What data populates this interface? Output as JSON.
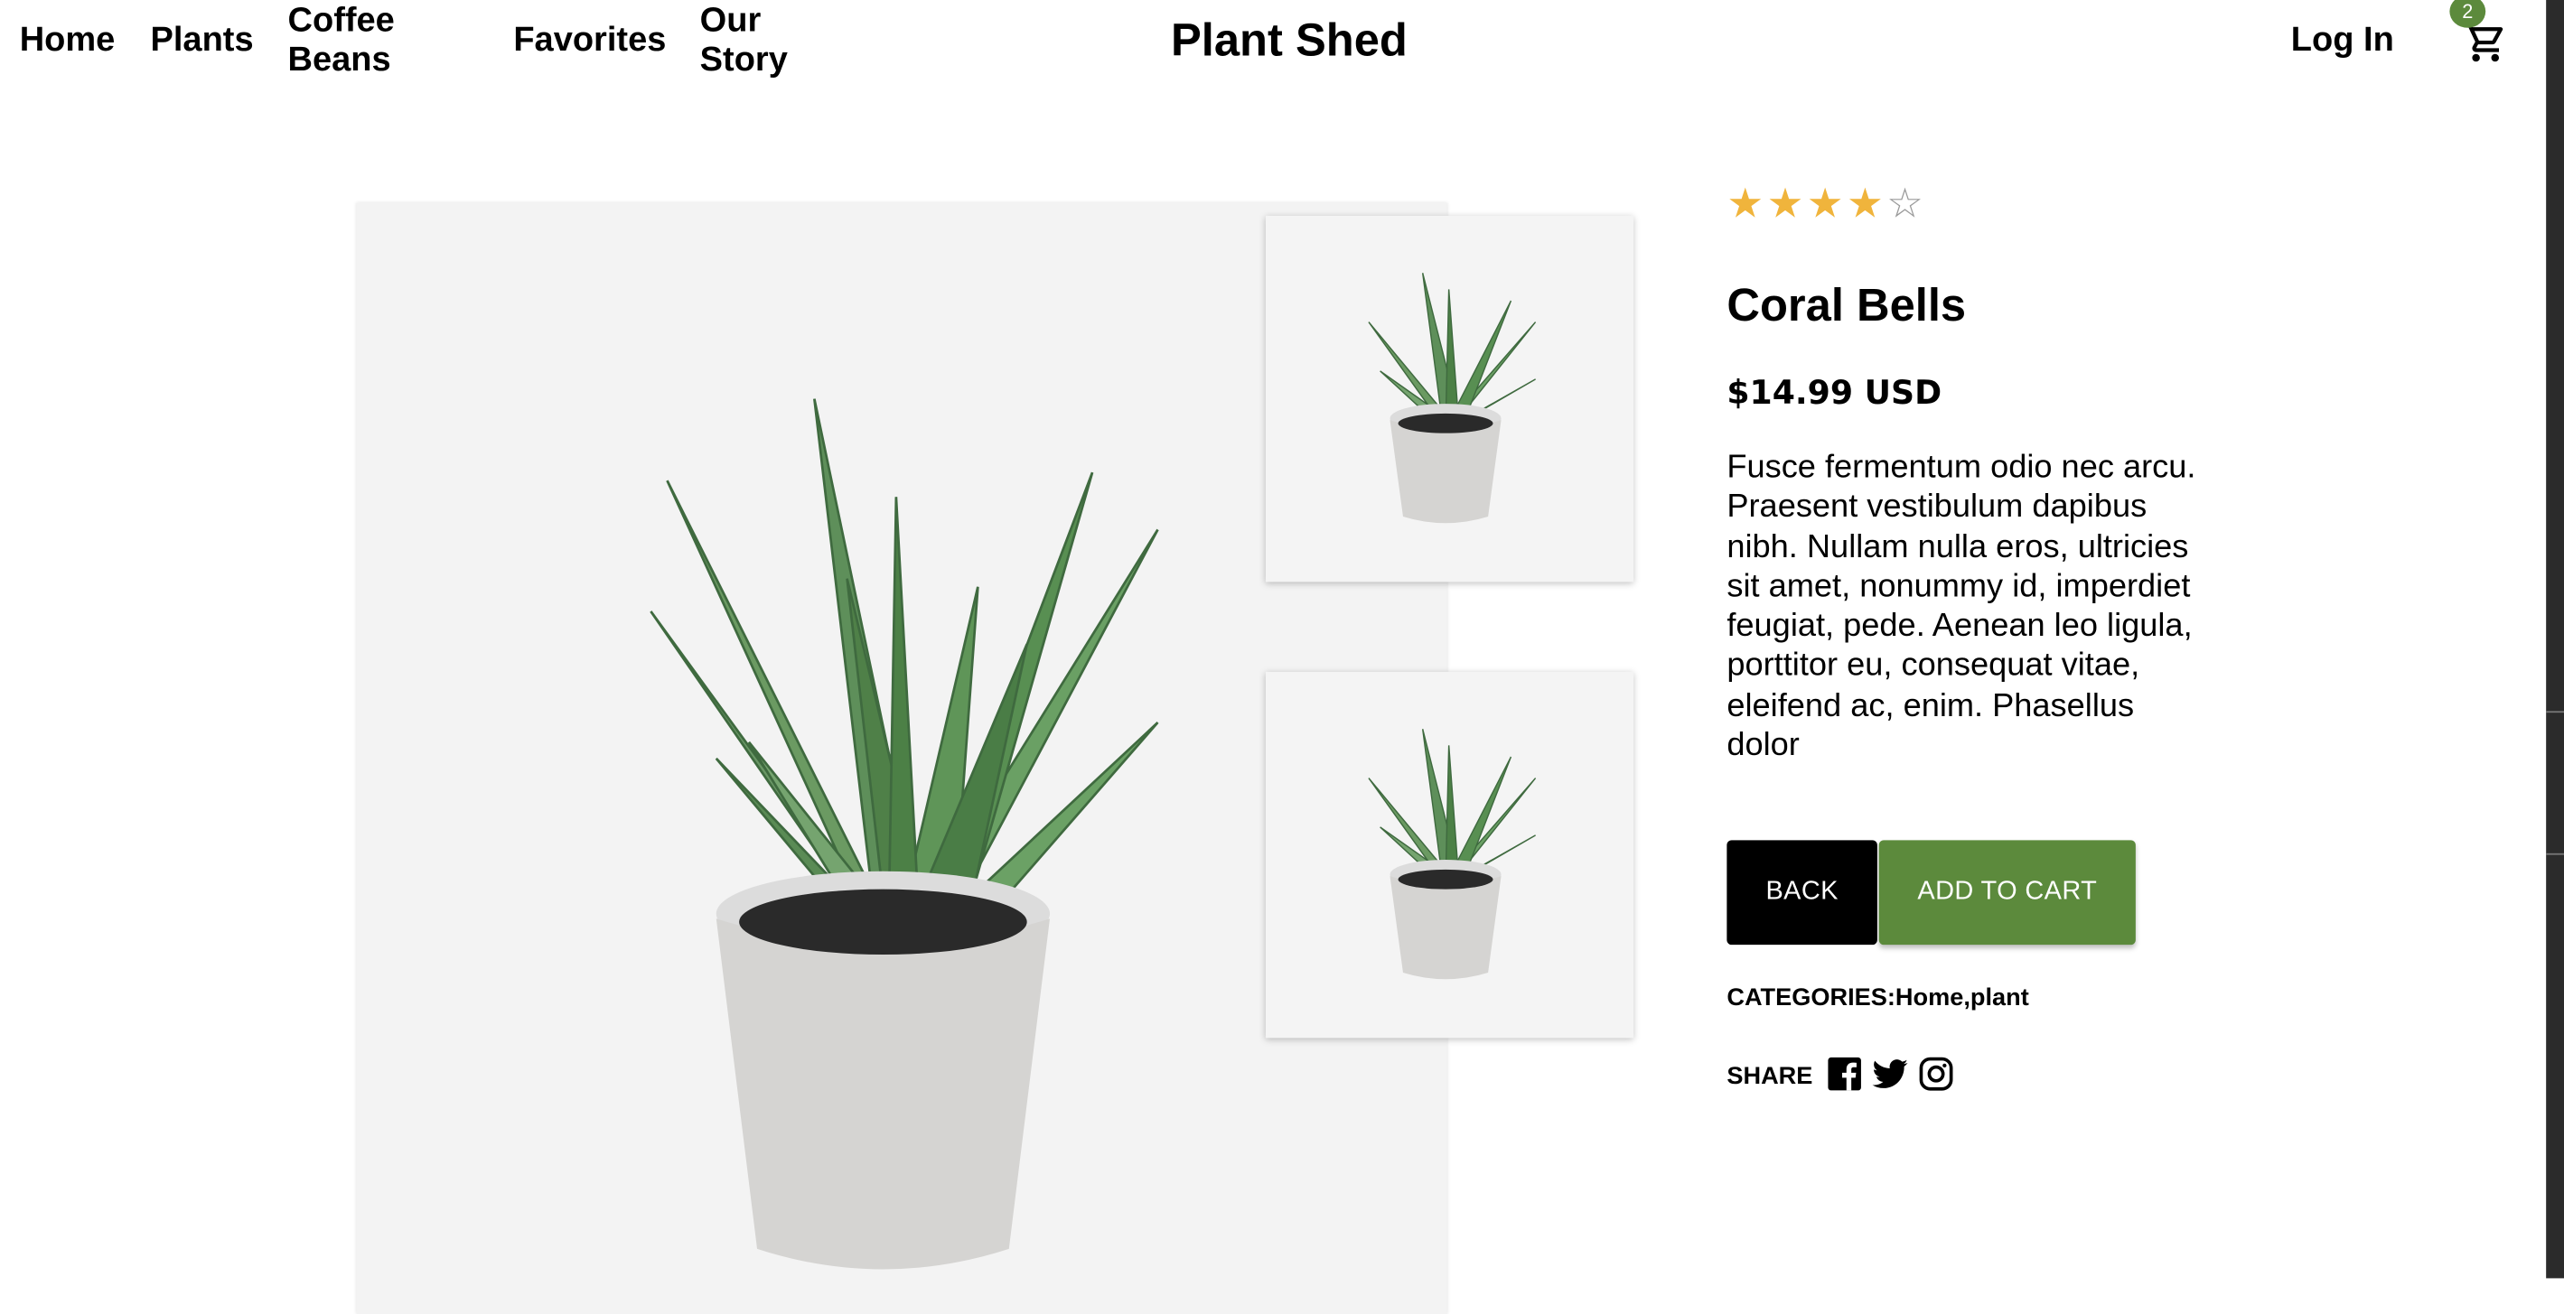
{
  "nav": {
    "links": [
      "Home",
      "Plants",
      "Coffee\nBeans",
      "Favorites",
      "Our\nStory"
    ],
    "brand": "Plant Shed",
    "login": "Log In",
    "cart_count": "2",
    "cart_icon": "cart-icon"
  },
  "product": {
    "rating": 4,
    "rating_max": 5,
    "title": "Coral Bells",
    "price": "$14.99 USD",
    "description": "Fusce fermentum odio nec arcu. Praesent vestibulum dapibus nibh. Nullam nulla eros, ultricies sit amet, nonummy id, imperdiet feugiat, pede. Aenean leo ligula, porttitor eu, consequat vitae, eleifend ac, enim. Phasellus dolor",
    "back_label": "BACK",
    "add_label": "ADD TO CART",
    "categories_label": "CATEGORIES:",
    "categories_value": "Home,plant",
    "share_label": "SHARE",
    "share_icons": [
      "facebook-icon",
      "twitter-icon",
      "instagram-icon"
    ]
  },
  "colors": {
    "accent_green": "#5c8a3c",
    "star_gold": "#f0b43c",
    "star_empty": "#9a9a9a",
    "button_black": "#000000"
  }
}
